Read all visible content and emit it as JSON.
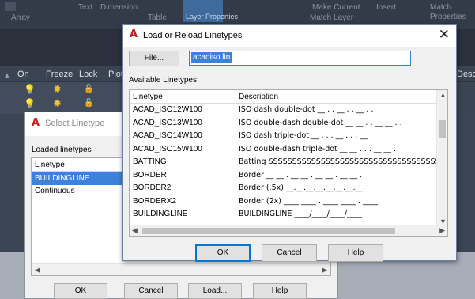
{
  "ribbon": {
    "array_label": "Array",
    "text_label": "Text",
    "dimension_label": "Dimension",
    "table_label": "Table",
    "properties_label": "Layer Properties",
    "make_current_label": "Make Current",
    "match_layer_label": "Match Layer",
    "insert_label": "Insert",
    "match_properties_label": "Match Properties"
  },
  "layer_manager": {
    "columns": [
      "On",
      "Freeze",
      "Lock",
      "Plot"
    ],
    "desc_col": "Descrip"
  },
  "select_linetype": {
    "title": "Select Linetype",
    "loaded_label": "Loaded linetypes",
    "column_header": "Linetype",
    "items": [
      "BUILDINGLINE",
      "Continuous"
    ],
    "selected_index": 0,
    "buttons": {
      "ok": "OK",
      "cancel": "Cancel",
      "load": "Load...",
      "help": "Help"
    }
  },
  "load_dialog": {
    "title": "Load or Reload Linetypes",
    "close_glyph": "✕",
    "file_button": "File...",
    "file_value": "acadiso.lin",
    "available_label": "Available Linetypes",
    "columns": {
      "linetype": "Linetype",
      "description": "Description"
    },
    "rows": [
      {
        "name": "ACAD_ISO12W100",
        "desc": "ISO dash double-dot __ . . __ . . __ . ."
      },
      {
        "name": "ACAD_ISO13W100",
        "desc": "ISO double-dash double-dot __ __ . . __ __ . ."
      },
      {
        "name": "ACAD_ISO14W100",
        "desc": "ISO dash triple-dot __ . . . __ . . . __"
      },
      {
        "name": "ACAD_ISO15W100",
        "desc": "ISO double-dash triple-dot __ __ . . . __ __ ."
      },
      {
        "name": "BATTING",
        "desc": "Batting SSSSSSSSSSSSSSSSSSSSSSSSSSSSSSSSSSSSSSSS"
      },
      {
        "name": "BORDER",
        "desc": "Border __ __ . __ __ . __ __ . __ __ ."
      },
      {
        "name": "BORDER2",
        "desc": "Border (.5x) __.__.__.__.__.__.__.__."
      },
      {
        "name": "BORDERX2",
        "desc": "Border (2x) ____ ____ . ____ ____ . ____"
      },
      {
        "name": "BUILDINGLINE",
        "desc": "BUILDINGLINE ____/____/____/____"
      }
    ],
    "buttons": {
      "ok": "OK",
      "cancel": "Cancel",
      "help": "Help"
    }
  },
  "colors": {
    "accent_blue": "#0078d7",
    "selection_blue": "#3d82d9",
    "acad_red": "#c8201e",
    "dark_bg": "#3b4453"
  }
}
